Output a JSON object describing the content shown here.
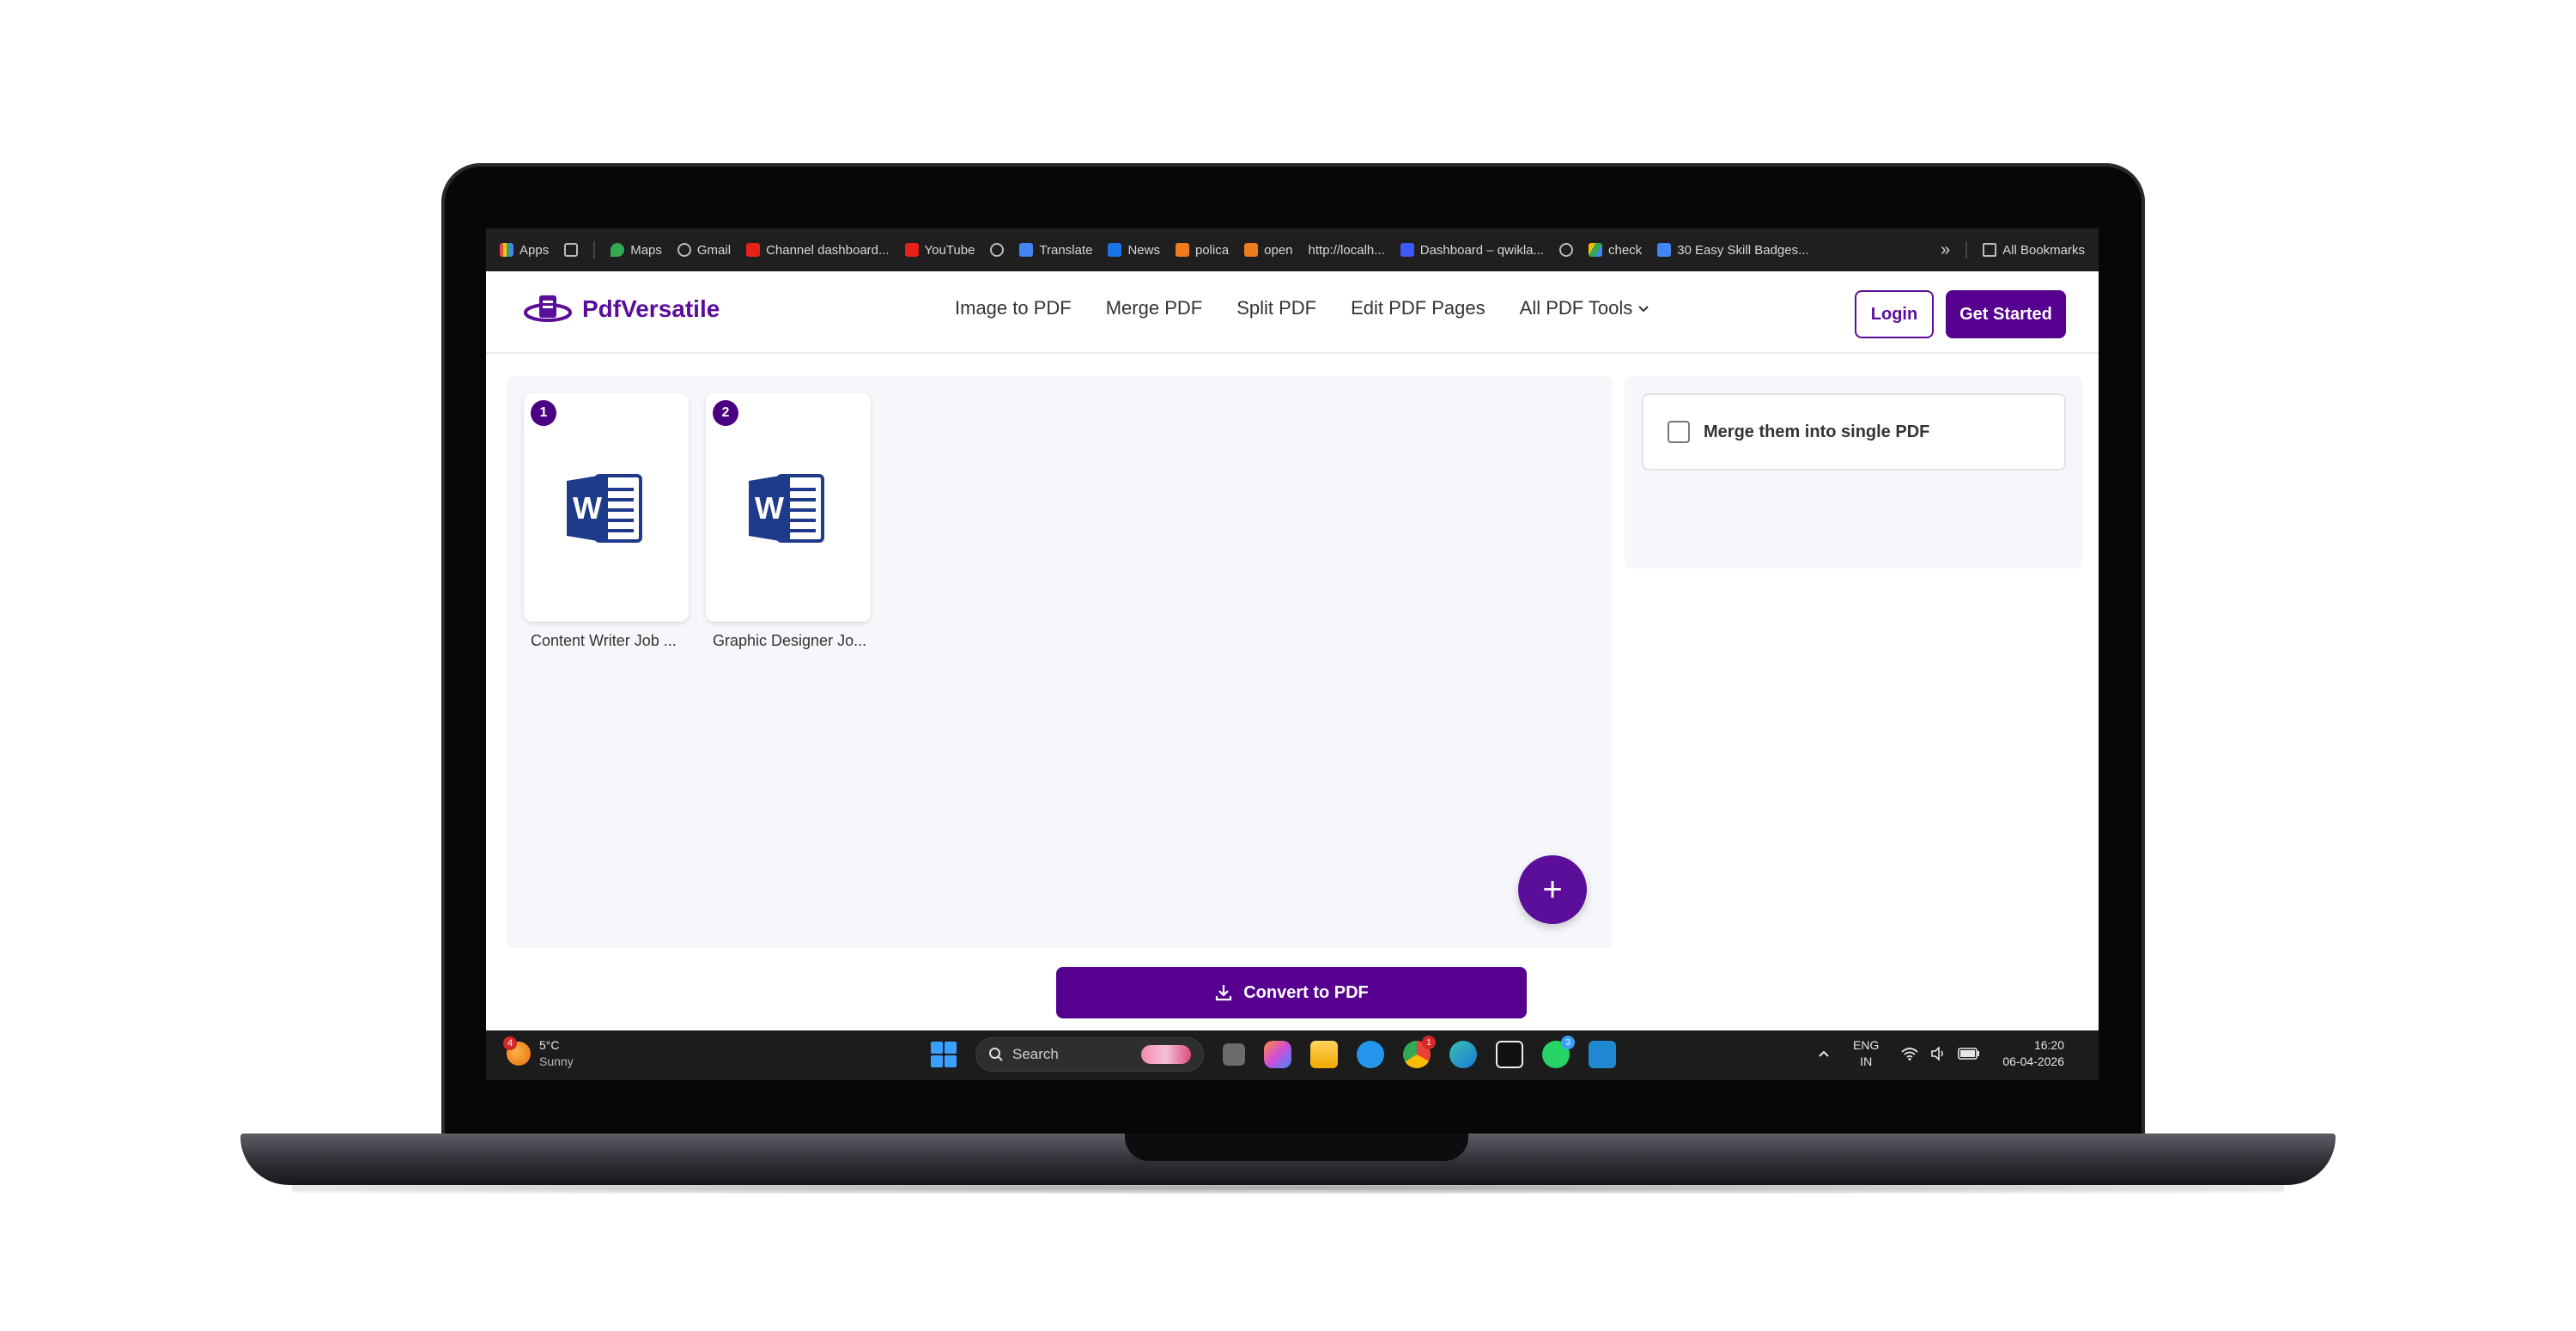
{
  "bookmarks": {
    "items": [
      "Apps",
      "Maps",
      "Gmail",
      "Channel dashboard...",
      "YouTube",
      "Translate",
      "News",
      "polica",
      "open",
      "http://localh...",
      "Dashboard – qwikla...",
      "check",
      "30 Easy Skill Badges..."
    ],
    "overflow": "»",
    "all_bookmarks": "All Bookmarks"
  },
  "site": {
    "brand": "PdfVersatile",
    "nav": [
      "Image to PDF",
      "Merge PDF",
      "Split PDF",
      "Edit PDF Pages",
      "All PDF Tools"
    ],
    "login": "Login",
    "get_started": "Get Started"
  },
  "files": [
    {
      "index": "1",
      "name": "Content Writer Job ...",
      "icon": "word-document-icon"
    },
    {
      "index": "2",
      "name": "Graphic Designer Jo...",
      "icon": "word-document-icon"
    }
  ],
  "add_button": "+",
  "options": {
    "merge_label": "Merge them into single PDF",
    "merge_checked": false
  },
  "convert_button": "Convert to PDF",
  "taskbar": {
    "weather_badge": "4",
    "temperature": "5°C",
    "condition": "Sunny",
    "search_placeholder": "Search",
    "chrome_badge": "1",
    "whatsapp_badge": "3",
    "lang_top": "ENG",
    "lang_bottom": "IN",
    "time": "16:20",
    "date": "06-04-2026"
  },
  "colors": {
    "brand": "#55008f",
    "word_blue": "#1e3a8a"
  }
}
